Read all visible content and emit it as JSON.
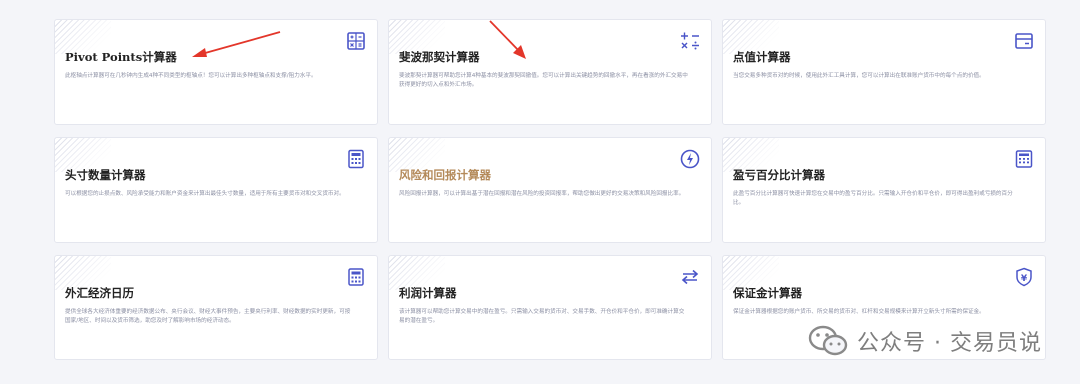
{
  "cards": [
    {
      "title": "Pivot Points计算器",
      "desc": "此枢轴点计算器可在几秒钟内生成4种不同类型的枢轴点！您可以计算出多种枢轴点和支撑/阻力水平。",
      "icon": "calculator-icon"
    },
    {
      "title": "斐波那契计算器",
      "desc": "斐波那契计算器可帮助您计算4种基本的斐波那契回撤值。您可以计算出关键趋势的回撤水平，再在看涨的外汇交易中获得更好的切入点和外汇市场。",
      "icon": "math-operations-icon"
    },
    {
      "title": "点值计算器",
      "desc": "当您交易多种货币对的时候，使用此外汇工具计算，您可以计算出在联准账户货币中的每个点的价值。",
      "icon": "wallet-card-icon"
    },
    {
      "title": "头寸数量计算器",
      "desc": "可以根据您的止损点数、风险承受能力和账户资金来计算出最佳头寸数量，适用于所有主要货币对和交叉货币对。",
      "icon": "calculator-keypad-icon"
    },
    {
      "title": "风险和回报计算器",
      "desc": "风险回报计算器，可以计算出基于潜在回报和潜在风险的投资回报率，帮助您做出更好的交易决策和风险回报比率。",
      "icon": "lightning-icon"
    },
    {
      "title": "盈亏百分比计算器",
      "desc": "此盈亏百分比计算器可快速计算您在交易中的盈亏百分比。只需输入开仓价和平仓价，即可得出盈利或亏损的百分比。",
      "icon": "keypad-calculator-icon"
    },
    {
      "title": "外汇经济日历",
      "desc": "提供全球各大经济体重要的经济数据公布、央行会议、财经大事件预告，主要央行利率、财经数据的实时更新，可按国家/地区、时间以及货币筛选，助您及时了解影响市场的经济动态。",
      "icon": "calendar-grid-icon"
    },
    {
      "title": "利润计算器",
      "desc": "该计算器可以帮助您计算交易中的潜在盈亏。只需输入交易的货币对、交易手数、开仓价和平仓价，即可准确计算交易的潜在盈亏。",
      "icon": "swap-arrows-icon"
    },
    {
      "title": "保证金计算器",
      "desc": "保证金计算器根据您的账户货币、所交易的货币对、杠杆和交易规模来计算开立新头寸所需的保证金。",
      "icon": "currency-shield-icon"
    }
  ],
  "watermark": {
    "text": "公众号 · 交易员说",
    "icon": "wechat-icon"
  },
  "colors": {
    "icon": "#4a55c8",
    "annotation": "#e3362a",
    "title_highlight": "#b48a5a"
  }
}
